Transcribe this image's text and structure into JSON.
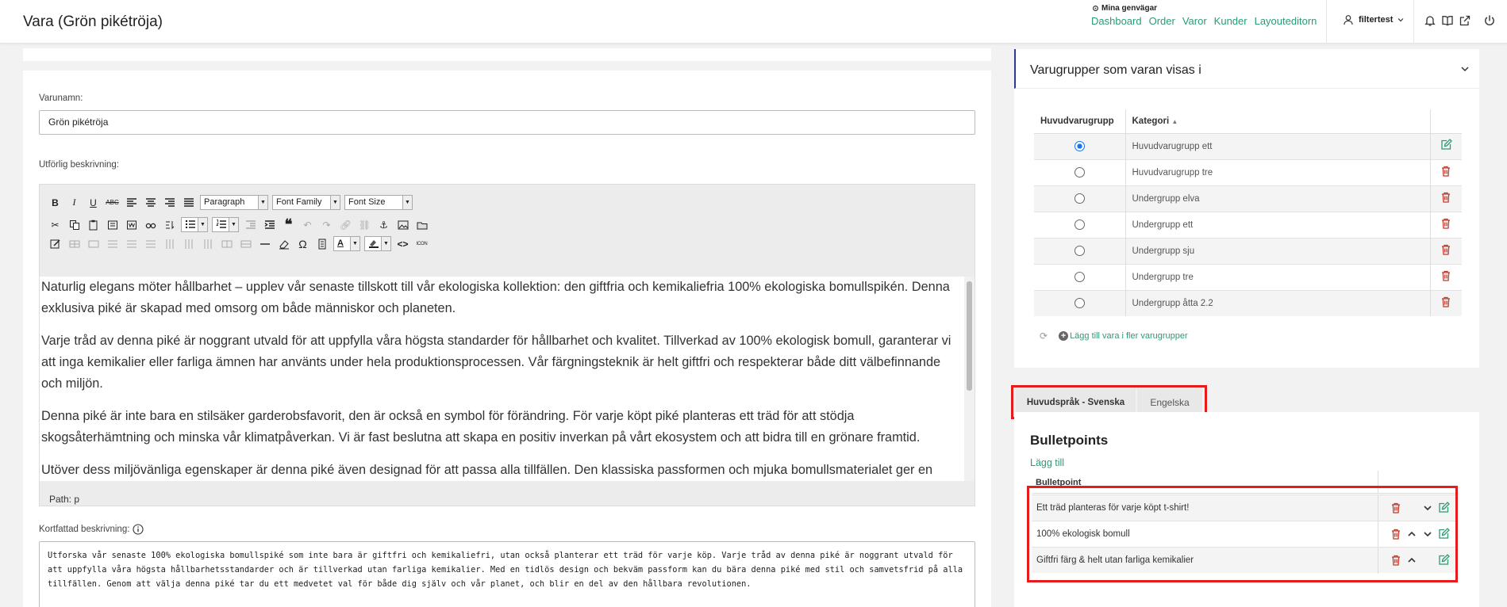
{
  "header": {
    "page_title": "Vara (Grön pikétröja)",
    "shortcuts_title": "Mina genvägar",
    "shortcuts": [
      "Dashboard",
      "Order",
      "Varor",
      "Kunder",
      "Layouteditorn"
    ],
    "user_name": "filtertest"
  },
  "product": {
    "name_label": "Varunamn:",
    "name_value": "Grön pikétröja",
    "long_desc_label": "Utförlig beskrivning:",
    "short_desc_label": "Kortfattad beskrivning:",
    "short_desc_value": "Utforska vår senaste 100% ekologiska bomullspiké som inte bara är giftfri och kemikaliefri, utan också planterar ett träd för varje köp. Varje tråd av denna piké är noggrant utvald för att uppfylla våra högsta hållbarhetsstandarder och är tillverkad utan farliga kemikalier. Med en tidlös design och bekväm passform kan du bära denna piké med stil och samvetsfrid på alla tillfällen. Genom att välja denna piké tar du ett medvetet val för både dig själv och vår planet, och blir en del av den hållbara revolutionen."
  },
  "editor": {
    "format_select": "Paragraph",
    "font_family_select": "Font Family",
    "font_size_select": "Font Size",
    "path": "Path: p",
    "paragraphs": [
      "Naturlig elegans möter hållbarhet – upplev vår senaste tillskott till vår ekologiska kollektion: den giftfria och kemikaliefria 100% ekologiska bomullspikén. Denna exklusiva piké är skapad med omsorg om både människor och planeten.",
      "Varje tråd av denna piké är noggrant utvald för att uppfylla våra högsta standarder för hållbarhet och kvalitet. Tillverkad av 100% ekologisk bomull, garanterar vi att inga kemikalier eller farliga ämnen har använts under hela produktionsprocessen. Vår färgningsteknik är helt giftfri och respekterar både ditt välbefinnande och miljön.",
      "Denna piké är inte bara en stilsäker garderobsfavorit, den är också en symbol för förändring. För varje köpt piké planteras ett träd för att stödja skogsåterhämtning och minska vår klimatpåverkan. Vi är fast beslutna att skapa en positiv inverkan på vårt ekosystem och att bidra till en grönare framtid.",
      "Utöver dess miljövänliga egenskaper är denna piké även designad för att passa alla tillfällen. Den klassiska passformen och mjuka bomullsmaterialet ger en"
    ]
  },
  "groups": {
    "title": "Varugrupper som varan visas i",
    "col_main": "Huvudvarugrupp",
    "col_category": "Kategori",
    "rows": [
      {
        "name": "Huvudvarugrupp ett",
        "main": true
      },
      {
        "name": "Huvudvarugrupp tre",
        "main": false
      },
      {
        "name": "Undergrupp elva",
        "main": false
      },
      {
        "name": "Undergrupp ett",
        "main": false
      },
      {
        "name": "Undergrupp sju",
        "main": false
      },
      {
        "name": "Undergrupp tre",
        "main": false
      },
      {
        "name": "Undergrupp åtta 2.2",
        "main": false
      }
    ],
    "add_label": "Lägg till vara i fler varugrupper"
  },
  "languages": {
    "tabs": [
      "Huvudspråk - Svenska",
      "Engelska"
    ],
    "active": "Huvudspråk - Svenska"
  },
  "bullets": {
    "title": "Bulletpoints",
    "add_label": "Lägg till",
    "col_header": "Bulletpoint",
    "items": [
      "Ett träd planteras för varje köpt t-shirt!",
      "100% ekologisk bomull",
      "Giftfri färg & helt utan farliga kemikalier"
    ]
  },
  "colors": {
    "accent_green": "#2b9b76",
    "delete_red": "#c0392b",
    "highlight_red": "#e61b1b",
    "radio_blue": "#1a73e8"
  }
}
